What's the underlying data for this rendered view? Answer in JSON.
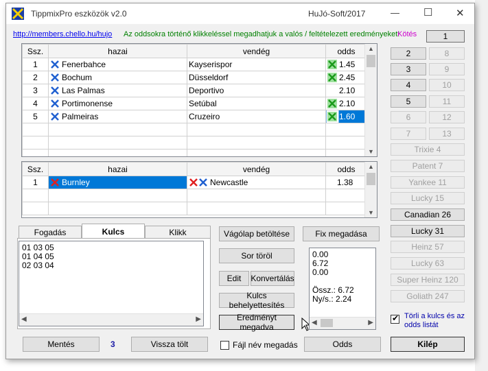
{
  "window": {
    "title": "TippmixPro eszközök  v2.0",
    "vendor": "HuJó-Soft/2017",
    "controls": {
      "minimize": "—",
      "maximize": "☐",
      "close": "✕"
    }
  },
  "header": {
    "link": "http://members.chello.hu/hujo",
    "hint": "Az oddsokra történő klikkeléssel megadhatjuk a valós /  feltételezett eredményeket!",
    "kotes": "Kötés"
  },
  "matches": {
    "columns": [
      "Ssz.",
      "hazai",
      "vendég",
      "odds"
    ],
    "rows": [
      {
        "n": "1",
        "home": "Fenerbahce",
        "away": "Kayserispor",
        "odds": "1.45",
        "mark": "green"
      },
      {
        "n": "2",
        "home": "Bochum",
        "away": "Düsseldorf",
        "odds": "2.45",
        "mark": "green"
      },
      {
        "n": "3",
        "home": "Las Palmas",
        "away": "Deportivo",
        "odds": "2.10",
        "mark": ""
      },
      {
        "n": "4",
        "home": "Portimonense",
        "away": "Setúbal",
        "odds": "2.10",
        "mark": "green"
      },
      {
        "n": "5",
        "home": "Palmeiras",
        "away": "Cruzeiro",
        "odds": "1.60",
        "mark": "green"
      }
    ]
  },
  "bankers": {
    "columns": [
      "Ssz.",
      "hazai",
      "vendég",
      "odds"
    ],
    "rows": [
      {
        "n": "1",
        "home": "Burnley",
        "away": "Newcastle",
        "odds": "1.38"
      }
    ]
  },
  "number_buttons": [
    "1",
    "2",
    "8",
    "3",
    "9",
    "4",
    "10",
    "5",
    "11",
    "6",
    "12",
    "7",
    "13"
  ],
  "systems": [
    "Trixie 4",
    "Patent 7",
    "Yankee 11",
    "Lucky 15",
    "Canadian 26",
    "Lucky 31",
    "Heinz 57",
    "Lucky 63",
    "Super Heinz 120",
    "Goliath 247"
  ],
  "tabs": [
    "Fogadás",
    "Kulcs",
    "Klikk"
  ],
  "key_lines": [
    "01 03 05",
    "01 04 05",
    "02 03 04"
  ],
  "results": {
    "lines": [
      "0.00",
      "6.72",
      "0.00"
    ],
    "sum": "Össz.: 6.72",
    "net": "Ny/s.: 2.24"
  },
  "buttons": {
    "clipboard": "Vágólap betöltése",
    "fix": "Fix megadása",
    "delete_row": "Sor töröl",
    "edit": "Edit",
    "convert": "Konvertálás",
    "replace_key": "Kulcs behelyettesítés",
    "enter_result": "Eredményt megadva",
    "save": "Mentés",
    "reload": "Vissza tölt",
    "odds": "Odds",
    "exit": "Kilép"
  },
  "counter": "3",
  "checkboxes": {
    "filename": "Fájl név megadás",
    "clear_keys": "Törli a kulcs és az odds listát"
  },
  "colors": {
    "accent_blue": "#0078d7",
    "link": "#0000ee",
    "hint_green": "#008000",
    "kotes_magenta": "#cc00cc",
    "counter_blue": "#1a1aa6"
  }
}
